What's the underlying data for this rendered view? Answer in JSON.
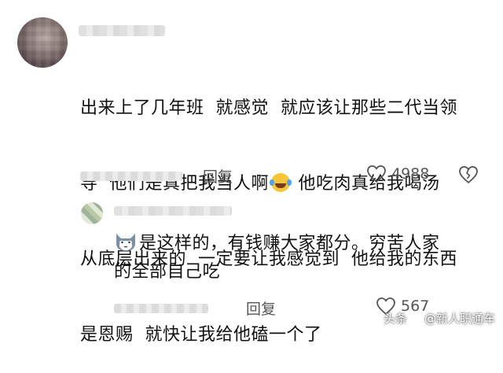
{
  "comment": {
    "line1": "出来上了几年班  就感觉  就应该让那些二代当领",
    "line2a": "导  他们是真把我当人啊",
    "line2b": " 他吃肉真给我喝汤",
    "line3": "从底层出来的  一定要让我感觉到  他给我的东西",
    "line4": "是恩赐  就快让我给他磕一个了",
    "reply_label": "回复",
    "like_count": "4988",
    "emoji_icon": "laughing-crying-emoji"
  },
  "reply": {
    "line1": "是这样的，有钱赚大家都分。穷苦人家",
    "line2": "的全部自己吃",
    "reply_label": "回复",
    "like_count": "567",
    "emoji_icon": "cat-emoji"
  },
  "watermark": {
    "prefix": "头条",
    "handle": "@新人职通车"
  },
  "colors": {
    "text": "#111111",
    "meta": "#555555",
    "background": "#ffffff"
  }
}
